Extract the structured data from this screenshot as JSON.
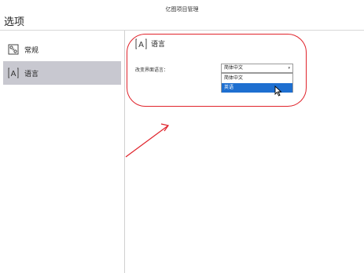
{
  "window": {
    "app_title": "亿图项目管理",
    "heading": "选项"
  },
  "sidebar": {
    "items": [
      {
        "label": "常规",
        "icon": "settings-sliders-icon",
        "active": false
      },
      {
        "label": "语言",
        "icon": "language-A-icon",
        "active": true
      }
    ]
  },
  "main": {
    "section_title": "语言",
    "field_label": "改变界面语言：",
    "select_value": "简体中文",
    "options": [
      "简体中文",
      "英语"
    ],
    "highlighted_option": "英语"
  },
  "annotation": {
    "color": "#e0232b"
  },
  "colors": {
    "active_bg": "#c8c8d0",
    "highlight_bg": "#1e6fd0"
  }
}
